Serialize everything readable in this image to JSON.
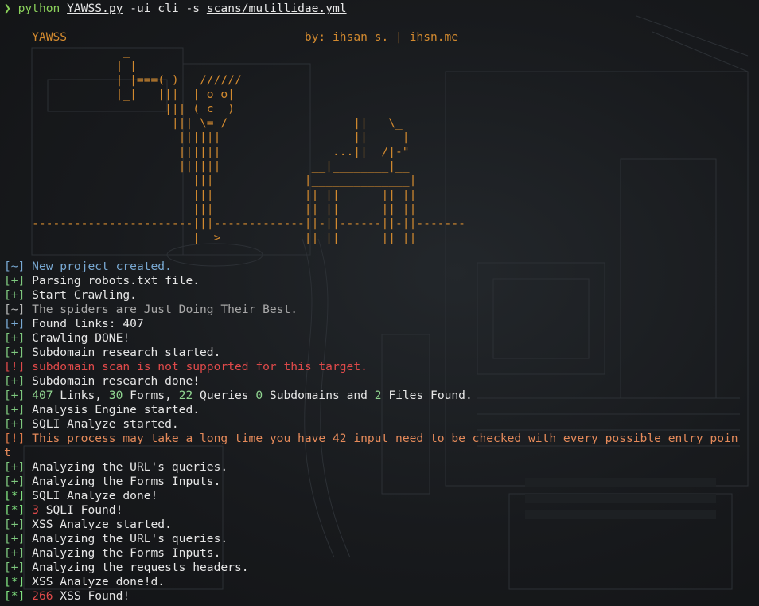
{
  "command": {
    "prompt_symbol": "❯",
    "program": "python",
    "script": "YAWSS.py",
    "flags": " -ui cli -s ",
    "scan_file": "scans/mutillidae.yml"
  },
  "header": {
    "app_name": "YAWSS",
    "byline": "by: ihsan s. | ihsn.me"
  },
  "ascii_art": [
    "                 _",
    "                | |",
    "                | |===( )   //////",
    "                |_|   |||  | o o|",
    "                       ||| ( c  )                  ____",
    "                        ||| \\= /                  ||   \\_",
    "                         ||||||                   ||     |",
    "                         ||||||                ...||__/|-\"",
    "                         ||||||             __|________|__",
    "                           |||             |______________|",
    "                           |||             || ||      || ||",
    "                           |||             || ||      || ||",
    "    -----------------------|||-------------||-||------||-||-------",
    "                           |__>            || ||      || ||"
  ],
  "log": [
    {
      "tag": "[~]",
      "tag_style": "info",
      "parts": [
        {
          "t": "New project created.",
          "s": "txt-info"
        }
      ]
    },
    {
      "tag": "[+]",
      "tag_style": "ok",
      "parts": [
        {
          "t": "Parsing robots.txt file.",
          "s": ""
        }
      ]
    },
    {
      "tag": "[+]",
      "tag_style": "ok",
      "parts": [
        {
          "t": "Start Crawling.",
          "s": ""
        }
      ]
    },
    {
      "tag": "[~]",
      "tag_style": "gray",
      "parts": [
        {
          "t": "The spiders are Just Doing Their Best.",
          "s": "txt-gray"
        }
      ]
    },
    {
      "tag": "[+]",
      "tag_style": "info",
      "parts": [
        {
          "t": "Found links: 407",
          "s": ""
        }
      ]
    },
    {
      "tag": "[+]",
      "tag_style": "ok",
      "parts": [
        {
          "t": "Crawling DONE!",
          "s": ""
        }
      ]
    },
    {
      "tag": "[+]",
      "tag_style": "ok",
      "parts": [
        {
          "t": "Subdomain research started.",
          "s": ""
        }
      ]
    },
    {
      "tag": "[!]",
      "tag_style": "err",
      "parts": [
        {
          "t": "subdomain scan is not supported for this target.",
          "s": "txt-err"
        }
      ]
    },
    {
      "tag": "[+]",
      "tag_style": "ok",
      "parts": [
        {
          "t": "Subdomain research done!",
          "s": ""
        }
      ]
    },
    {
      "tag": "[+]",
      "tag_style": "ok",
      "parts": [
        {
          "t": "407",
          "s": "num-g"
        },
        {
          "t": " Links, ",
          "s": ""
        },
        {
          "t": "30",
          "s": "num-g"
        },
        {
          "t": " Forms, ",
          "s": ""
        },
        {
          "t": "22",
          "s": "num-g"
        },
        {
          "t": " Queries ",
          "s": ""
        },
        {
          "t": "0",
          "s": "num-g"
        },
        {
          "t": " Subdomains and ",
          "s": ""
        },
        {
          "t": "2",
          "s": "num-g"
        },
        {
          "t": " Files Found.",
          "s": ""
        }
      ]
    },
    {
      "tag": "[+]",
      "tag_style": "ok",
      "parts": [
        {
          "t": "Analysis Engine started.",
          "s": ""
        }
      ]
    },
    {
      "tag": "[+]",
      "tag_style": "ok",
      "parts": [
        {
          "t": "SQLI Analyze started.",
          "s": ""
        }
      ]
    },
    {
      "tag": "[!]",
      "tag_style": "warn",
      "parts": [
        {
          "t": "This process may take a long time you have 42 input need to be checked with every possible entry poin",
          "s": "txt-warn"
        }
      ]
    },
    {
      "tag": "",
      "tag_style": "",
      "parts": [
        {
          "t": "t",
          "s": "txt-warn"
        }
      ]
    },
    {
      "tag": "[+]",
      "tag_style": "ok",
      "parts": [
        {
          "t": "Analyzing the URL's queries.",
          "s": ""
        }
      ]
    },
    {
      "tag": "[+]",
      "tag_style": "ok",
      "parts": [
        {
          "t": "Analyzing the Forms Inputs.",
          "s": ""
        }
      ]
    },
    {
      "tag": "[*]",
      "tag_style": "star",
      "parts": [
        {
          "t": "SQLI Analyze done!",
          "s": ""
        }
      ]
    },
    {
      "tag": "[*]",
      "tag_style": "star",
      "parts": [
        {
          "t": "3",
          "s": "num-r"
        },
        {
          "t": " SQLI Found!",
          "s": ""
        }
      ]
    },
    {
      "tag": "[+]",
      "tag_style": "ok",
      "parts": [
        {
          "t": "XSS Analyze started.",
          "s": ""
        }
      ]
    },
    {
      "tag": "[+]",
      "tag_style": "ok",
      "parts": [
        {
          "t": "Analyzing the URL's queries.",
          "s": ""
        }
      ]
    },
    {
      "tag": "[+]",
      "tag_style": "ok",
      "parts": [
        {
          "t": "Analyzing the Forms Inputs.",
          "s": ""
        }
      ]
    },
    {
      "tag": "[+]",
      "tag_style": "ok",
      "parts": [
        {
          "t": "Analyzing the requests headers.",
          "s": ""
        }
      ]
    },
    {
      "tag": "[*]",
      "tag_style": "star",
      "parts": [
        {
          "t": "XSS Analyze done!d.",
          "s": ""
        }
      ]
    },
    {
      "tag": "[*]",
      "tag_style": "star",
      "parts": [
        {
          "t": "266",
          "s": "num-r"
        },
        {
          "t": " XSS Found!",
          "s": ""
        }
      ]
    }
  ]
}
